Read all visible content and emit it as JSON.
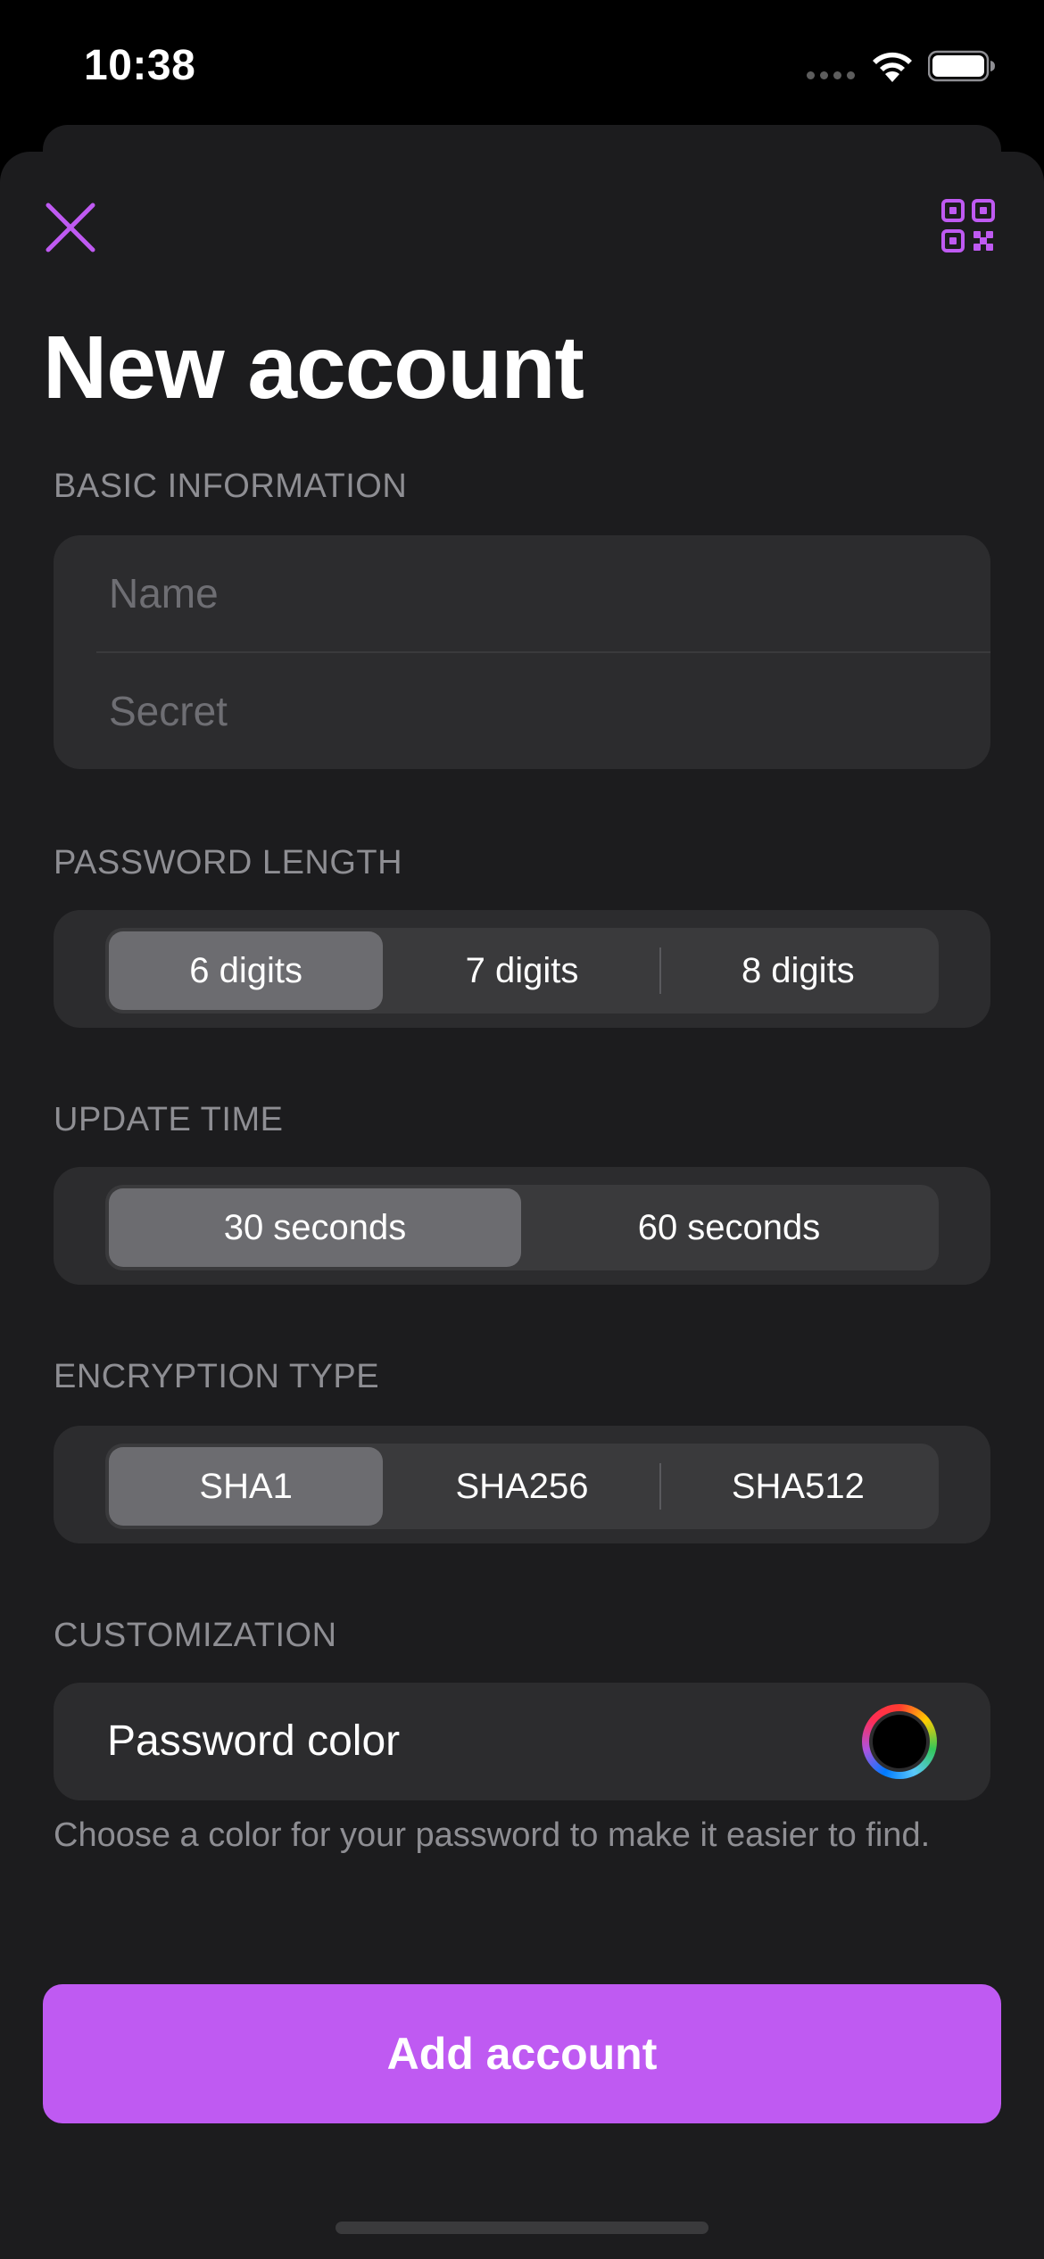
{
  "status_bar": {
    "time": "10:38"
  },
  "header": {
    "title": "New account",
    "close_icon": "close-icon",
    "qr_icon": "qr-code-icon"
  },
  "basic_information": {
    "header": "BASIC INFORMATION",
    "name_placeholder": "Name",
    "name_value": "",
    "secret_placeholder": "Secret",
    "secret_value": ""
  },
  "password_length": {
    "header": "PASSWORD LENGTH",
    "options": [
      "6 digits",
      "7 digits",
      "8 digits"
    ],
    "selected": "6 digits"
  },
  "update_time": {
    "header": "UPDATE TIME",
    "options": [
      "30 seconds",
      "60 seconds"
    ],
    "selected": "30 seconds"
  },
  "encryption_type": {
    "header": "ENCRYPTION TYPE",
    "options": [
      "SHA1",
      "SHA256",
      "SHA512"
    ],
    "selected": "SHA1"
  },
  "customization": {
    "header": "CUSTOMIZATION",
    "color_label": "Password color",
    "selected_color": "#000000",
    "footnote": "Choose a color for your password to make it easier to find."
  },
  "primary_action": {
    "label": "Add account"
  },
  "colors": {
    "accent": "#bf5af2",
    "background": "#1c1c1e",
    "group_background": "#2c2c2e",
    "secondary_text": "#8e8e93"
  }
}
